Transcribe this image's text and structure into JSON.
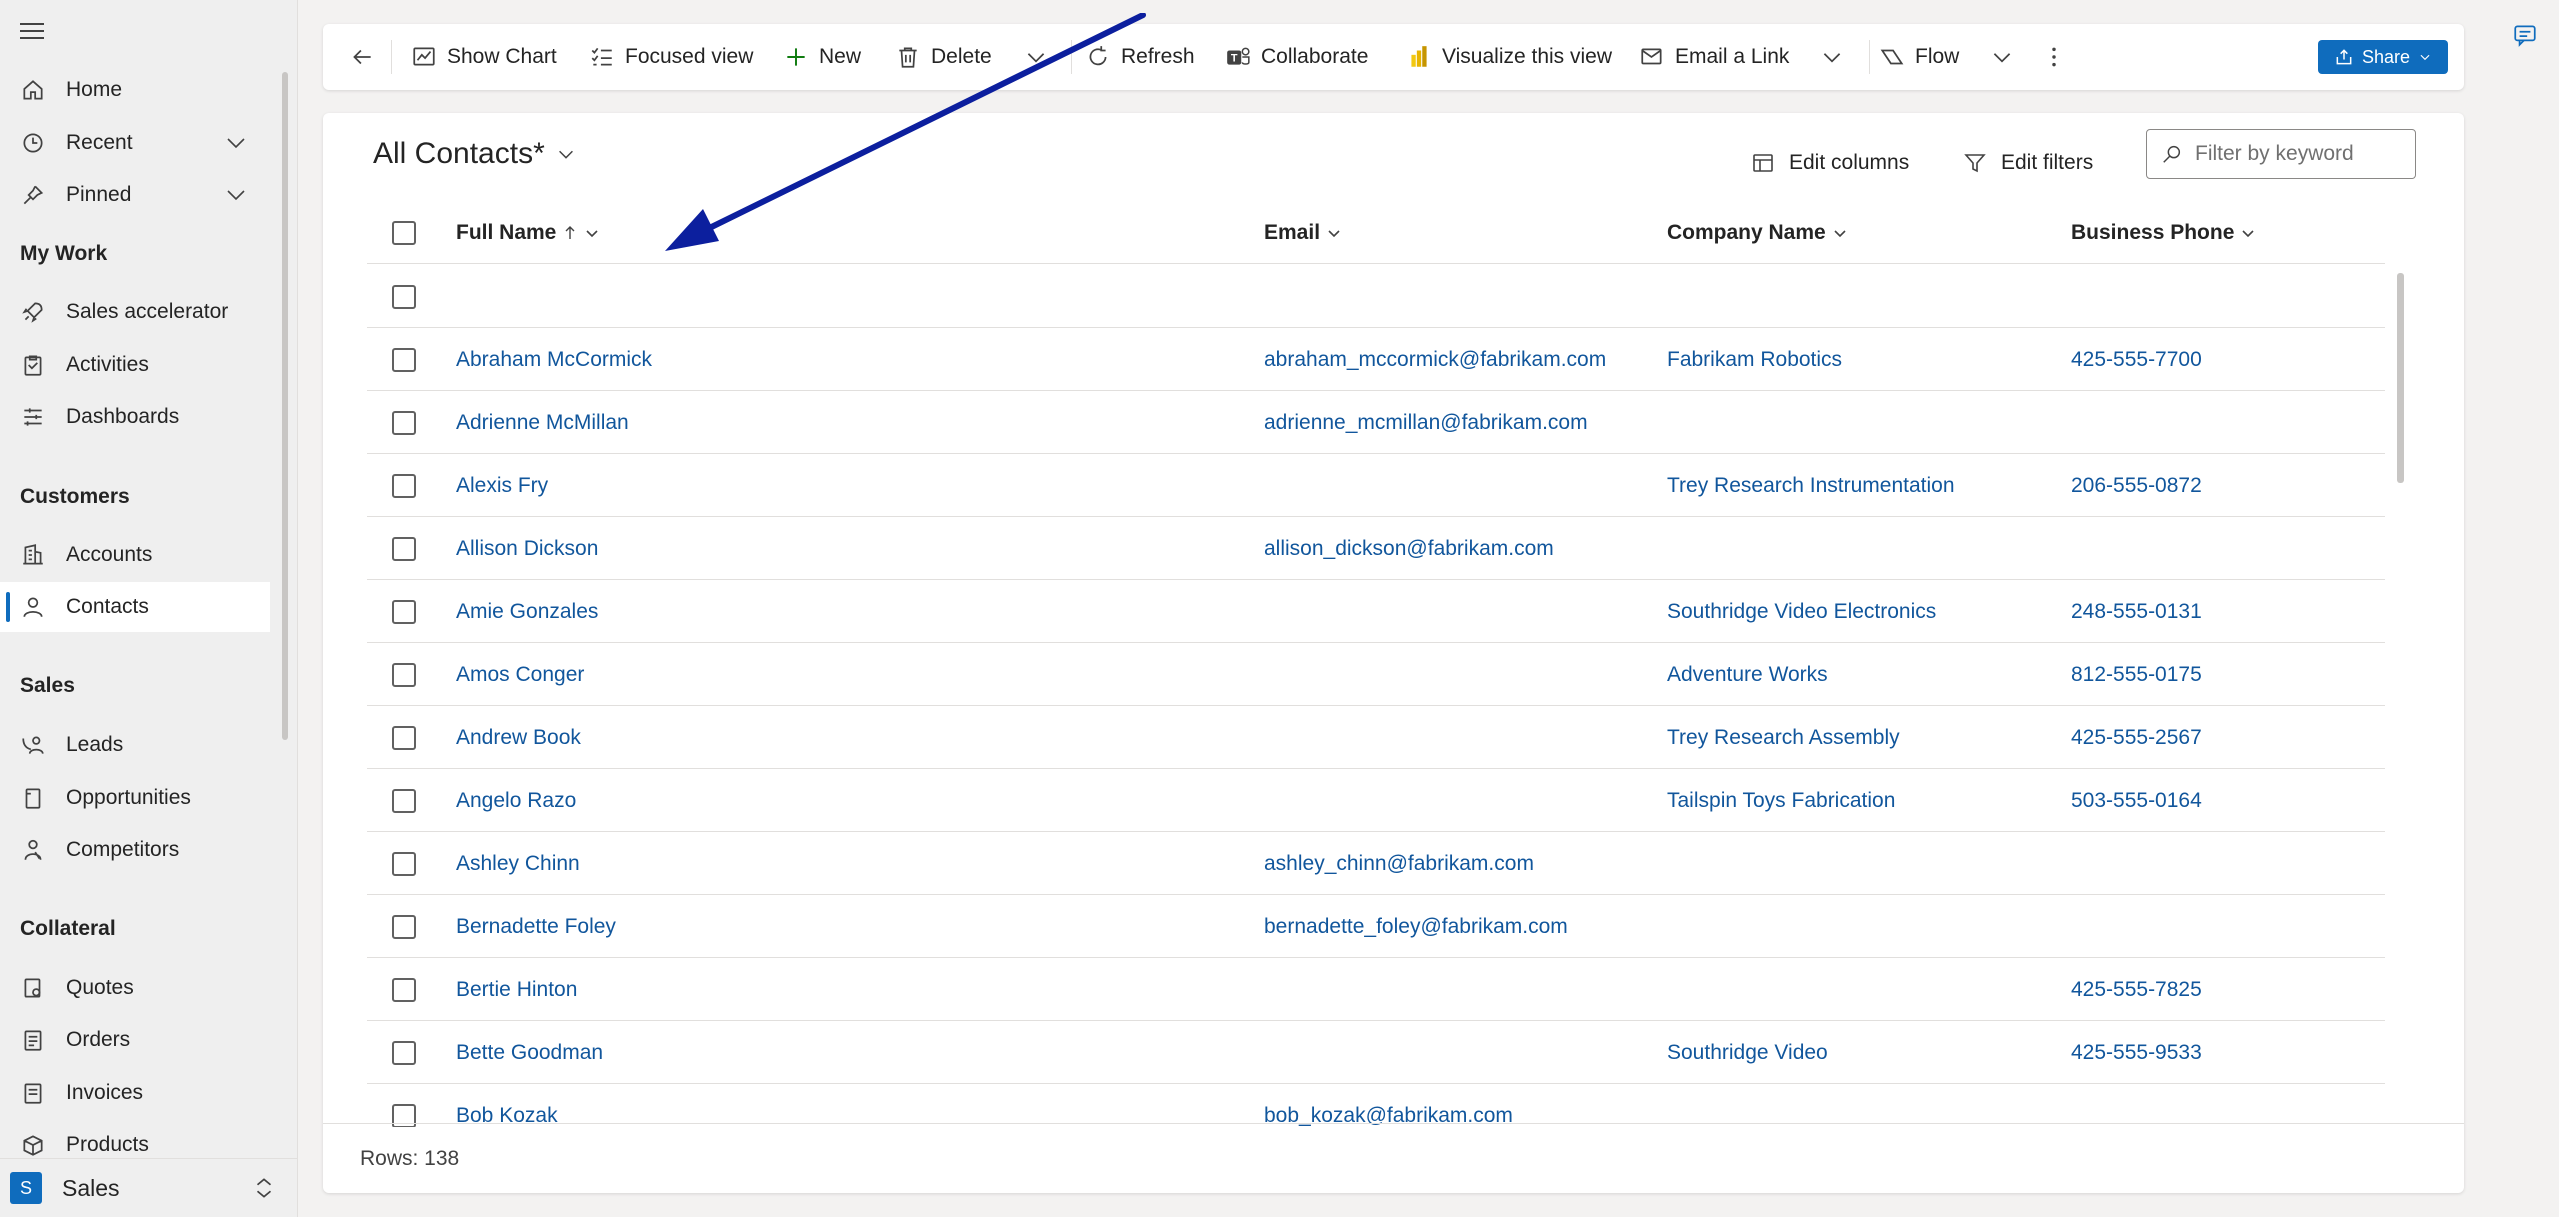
{
  "sidebar": {
    "items": [
      {
        "label": "Home",
        "icon": "home-icon"
      },
      {
        "label": "Recent",
        "icon": "clock-icon"
      },
      {
        "label": "Pinned",
        "icon": "pin-icon"
      }
    ],
    "sections": [
      {
        "title": "My Work",
        "items": [
          {
            "label": "Sales accelerator",
            "icon": "rocket-icon"
          },
          {
            "label": "Activities",
            "icon": "clipboard-icon"
          },
          {
            "label": "Dashboards",
            "icon": "dashboard-icon"
          }
        ]
      },
      {
        "title": "Customers",
        "items": [
          {
            "label": "Accounts",
            "icon": "building-icon"
          },
          {
            "label": "Contacts",
            "icon": "person-icon"
          }
        ]
      },
      {
        "title": "Sales",
        "items": [
          {
            "label": "Leads",
            "icon": "phone-person-icon"
          },
          {
            "label": "Opportunities",
            "icon": "document-icon"
          },
          {
            "label": "Competitors",
            "icon": "person-walking-icon"
          }
        ]
      },
      {
        "title": "Collateral",
        "items": [
          {
            "label": "Quotes",
            "icon": "quote-icon"
          },
          {
            "label": "Orders",
            "icon": "order-icon"
          },
          {
            "label": "Invoices",
            "icon": "invoice-icon"
          },
          {
            "label": "Products",
            "icon": "box-icon"
          }
        ]
      }
    ],
    "area": {
      "badge": "S",
      "label": "Sales"
    }
  },
  "toolbar": {
    "show_chart": "Show Chart",
    "focused_view": "Focused view",
    "new": "New",
    "delete": "Delete",
    "refresh": "Refresh",
    "collaborate": "Collaborate",
    "visualize": "Visualize this view",
    "email_link": "Email a Link",
    "flow": "Flow",
    "share": "Share"
  },
  "view": {
    "title": "All Contacts*",
    "edit_columns": "Edit columns",
    "edit_filters": "Edit filters",
    "filter_placeholder": "Filter by keyword"
  },
  "grid": {
    "columns": [
      "Full Name",
      "Email",
      "Company Name",
      "Business Phone"
    ],
    "rows": [
      {
        "name": "",
        "email": "",
        "company": "",
        "phone": ""
      },
      {
        "name": "Abraham McCormick",
        "email": "abraham_mccormick@fabrikam.com",
        "company": "Fabrikam Robotics",
        "phone": "425-555-7700"
      },
      {
        "name": "Adrienne McMillan",
        "email": "adrienne_mcmillan@fabrikam.com",
        "company": "",
        "phone": ""
      },
      {
        "name": "Alexis Fry",
        "email": "",
        "company": "Trey Research Instrumentation",
        "phone": "206-555-0872"
      },
      {
        "name": "Allison Dickson",
        "email": "allison_dickson@fabrikam.com",
        "company": "",
        "phone": ""
      },
      {
        "name": "Amie Gonzales",
        "email": "",
        "company": "Southridge Video Electronics",
        "phone": "248-555-0131"
      },
      {
        "name": "Amos Conger",
        "email": "",
        "company": "Adventure Works",
        "phone": "812-555-0175"
      },
      {
        "name": "Andrew Book",
        "email": "",
        "company": "Trey Research Assembly",
        "phone": "425-555-2567"
      },
      {
        "name": "Angelo Razo",
        "email": "",
        "company": "Tailspin Toys Fabrication",
        "phone": "503-555-0164"
      },
      {
        "name": "Ashley Chinn",
        "email": "ashley_chinn@fabrikam.com",
        "company": "",
        "phone": ""
      },
      {
        "name": "Bernadette Foley",
        "email": "bernadette_foley@fabrikam.com",
        "company": "",
        "phone": ""
      },
      {
        "name": "Bertie Hinton",
        "email": "",
        "company": "",
        "phone": "425-555-7825"
      },
      {
        "name": "Bette Goodman",
        "email": "",
        "company": "Southridge Video",
        "phone": "425-555-9533"
      },
      {
        "name": "Bob Kozak",
        "email": "bob_kozak@fabrikam.com",
        "company": "",
        "phone": ""
      }
    ],
    "rows_label": "Rows: 138"
  },
  "colors": {
    "accent": "#0f6cbd",
    "link": "#11569c",
    "annotation_arrow": "#0c1f9e"
  }
}
